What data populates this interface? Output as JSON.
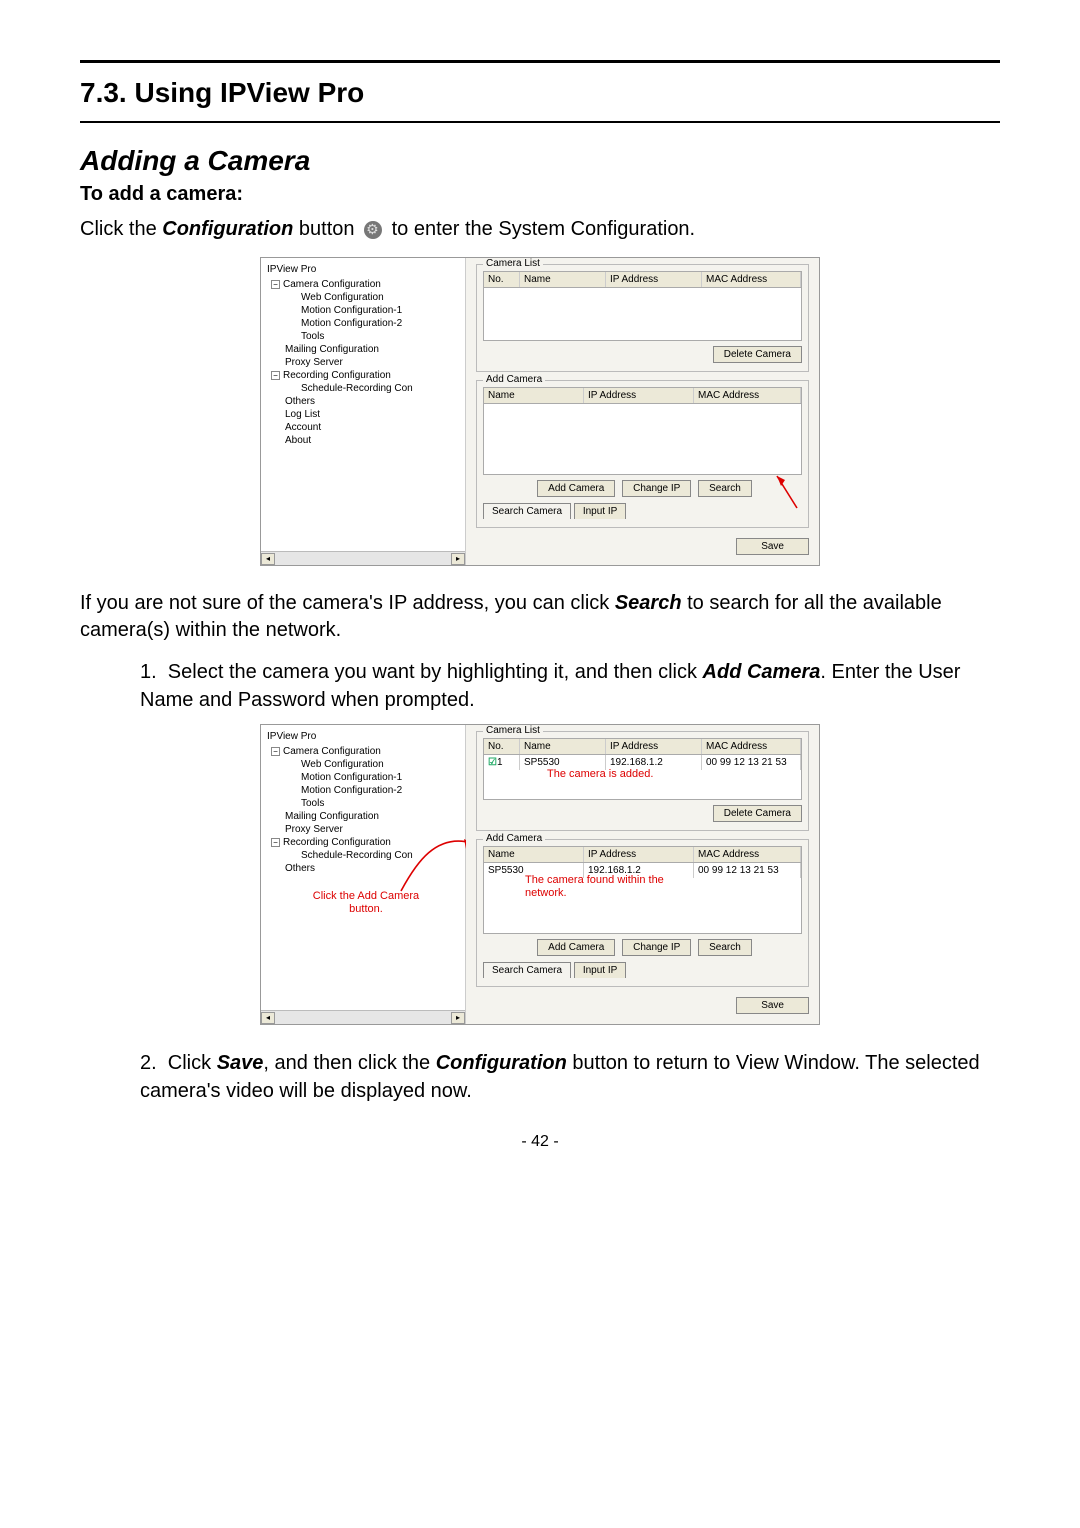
{
  "section_number": "7.3. Using IPView Pro",
  "subtitle": "Adding a Camera",
  "subhead": "To add a camera:",
  "intro_pre": "Click the ",
  "intro_bold": "Configuration",
  "intro_post": " button ",
  "intro_tail": " to enter the System Configuration.",
  "para2_pre": "If you are not sure of the camera's IP address, you can click ",
  "para2_bold": "Search",
  "para2_post": " to search for all the available camera(s) within the network.",
  "step1_pre": "Select the camera you want by highlighting it, and then click ",
  "step1_bold": "Add Camera",
  "step1_post": ".  Enter the User Name and Password when prompted.",
  "step2_a": "Click ",
  "step2_bold1": "Save",
  "step2_b": ", and then click the ",
  "step2_bold2": "Configuration",
  "step2_c": " button to return to View Window.  The selected camera's video will be displayed now.",
  "page_number": "- 42 -",
  "shot": {
    "app_title": "IPView Pro",
    "tree": {
      "root_a": "Camera Configuration",
      "a1": "Web Configuration",
      "a2": "Motion Configuration-1",
      "a3": "Motion Configuration-2",
      "a4": "Tools",
      "b": "Mailing Configuration",
      "c": "Proxy Server",
      "root_d": "Recording Configuration",
      "d1": "Schedule-Recording Con",
      "e": "Others",
      "f": "Log List",
      "g": "Account",
      "h": "About"
    },
    "camera_list_label": "Camera List",
    "add_camera_label": "Add Camera",
    "cols": {
      "no": "No.",
      "name": "Name",
      "ip": "IP Address",
      "mac": "MAC Address"
    },
    "buttons": {
      "delete": "Delete Camera",
      "add": "Add Camera",
      "change_ip": "Change IP",
      "search": "Search",
      "save": "Save"
    },
    "tabs": {
      "search_camera": "Search Camera",
      "input_ip": "Input IP"
    }
  },
  "shot2": {
    "camera_row": {
      "no": "1",
      "name": "SP5530",
      "ip": "192.168.1.2",
      "mac": "00 99 12 13 21 53"
    },
    "added_row": {
      "name": "SP5530",
      "ip": "192.168.1.2",
      "mac": "00 99 12 13 21 53"
    },
    "annot_added": "The camera is added.",
    "annot_click": "Click the Add Camera button.",
    "annot_found": "The camera found within the network."
  }
}
